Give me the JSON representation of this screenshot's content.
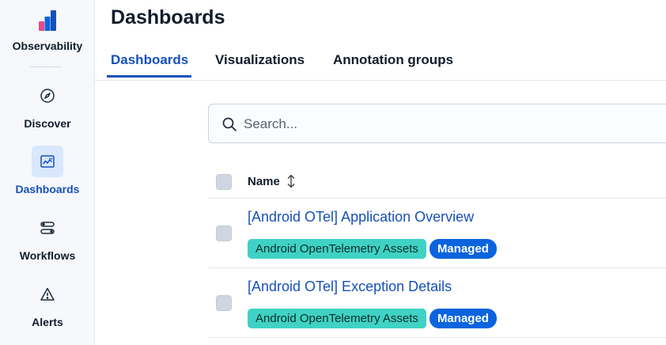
{
  "brand": {
    "name": "Observability"
  },
  "sidebar": {
    "items": [
      {
        "label": "Discover",
        "icon": "compass-icon",
        "active": false
      },
      {
        "label": "Dashboards",
        "icon": "dashboard-icon",
        "active": true
      },
      {
        "label": "Workflows",
        "icon": "workflow-icon",
        "active": false
      },
      {
        "label": "Alerts",
        "icon": "warning-icon",
        "active": false
      }
    ]
  },
  "page": {
    "title": "Dashboards"
  },
  "tabs": [
    {
      "label": "Dashboards",
      "active": true
    },
    {
      "label": "Visualizations",
      "active": false
    },
    {
      "label": "Annotation groups",
      "active": false
    }
  ],
  "search": {
    "placeholder": "Search...",
    "value": ""
  },
  "table": {
    "columns": [
      {
        "label": "Name",
        "sortable": true
      }
    ],
    "rows": [
      {
        "title": "[Android OTel] Application Overview",
        "tags": [
          "Android OpenTelemetry Assets"
        ],
        "managed_label": "Managed"
      },
      {
        "title": "[Android OTel] Exception Details",
        "tags": [
          "Android OpenTelemetry Assets"
        ],
        "managed_label": "Managed"
      }
    ]
  },
  "colors": {
    "accent": "#1750ba",
    "active_nav_bg": "#d9e8fe",
    "tag_teal": "#3fd2c4",
    "managed_blue": "#0b64dd"
  }
}
